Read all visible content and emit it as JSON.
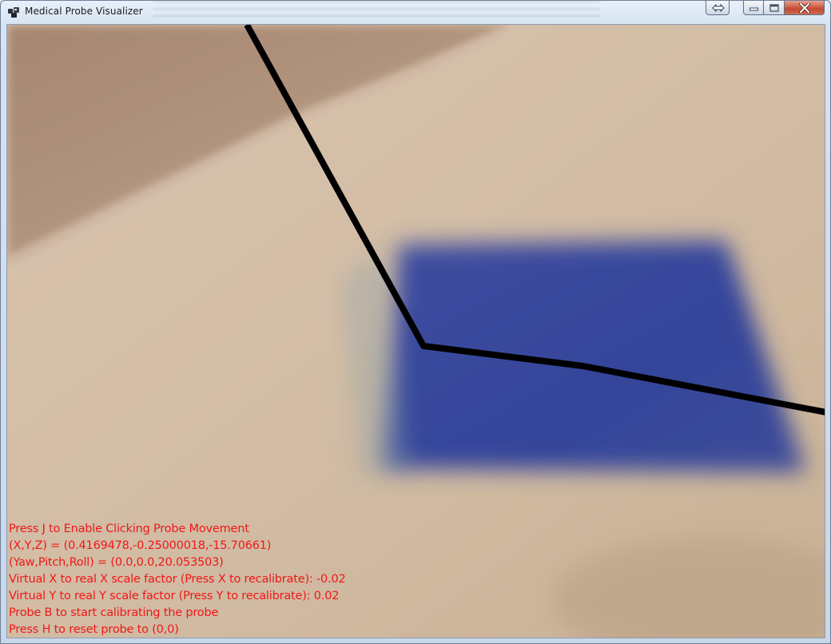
{
  "window": {
    "title": "Medical Probe Visualizer",
    "icon": "app-logo-icon",
    "controls": [
      "snap-icon",
      "minimize-icon",
      "maximize-icon",
      "close-icon"
    ]
  },
  "viewport": {
    "overlay_color": "#f01818",
    "probe_line_color": "#000000",
    "lines": [
      "Press J to Enable Clicking Probe Movement",
      "(X,Y,Z) = (0.4169478,-0.25000018,-15.70661)",
      "(Yaw,Pitch,Roll) = (0.0,0.0,20.053503)",
      "Virtual X to real X scale factor (Press X to recalibrate): -0.02",
      "Virtual Y to real Y scale factor (Press Y to recalibrate): 0.02",
      "Probe B to start calibrating the probe",
      "Press H to reset probe to (0,0)"
    ]
  }
}
